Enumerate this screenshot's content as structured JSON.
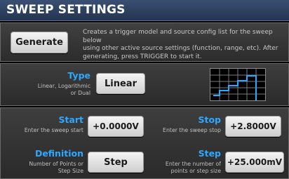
{
  "header": {
    "title": "SWEEP SETTINGS"
  },
  "generate": {
    "button_label": "Generate",
    "description_lines": [
      "Creates a trigger model and source config list for the sweep below",
      "using other active source settings (function, range, etc). After",
      "generating, press TRIGGER to start it."
    ]
  },
  "type": {
    "title": "Type",
    "subtitle_lines": [
      "Linear, Logarithmic",
      "or Dual"
    ],
    "value": "Linear"
  },
  "start": {
    "title": "Start",
    "subtitle_lines": [
      "Enter the sweep start"
    ],
    "value": "+0.0000V"
  },
  "stop": {
    "title": "Stop",
    "subtitle_lines": [
      "Enter the sweep stop"
    ],
    "value": "+2.8000V"
  },
  "definition": {
    "title": "Definition",
    "subtitle_lines": [
      "Number of Points or",
      "Step Size"
    ],
    "value": "Step"
  },
  "step": {
    "title": "Step",
    "subtitle_lines": [
      "Enter the number of",
      "points or step size"
    ],
    "value": "+25.000mV"
  },
  "colors": {
    "header_bg": "#2b3d5c",
    "accent_label": "#2ea8ff",
    "graph_trace": "#2ea8ff"
  }
}
